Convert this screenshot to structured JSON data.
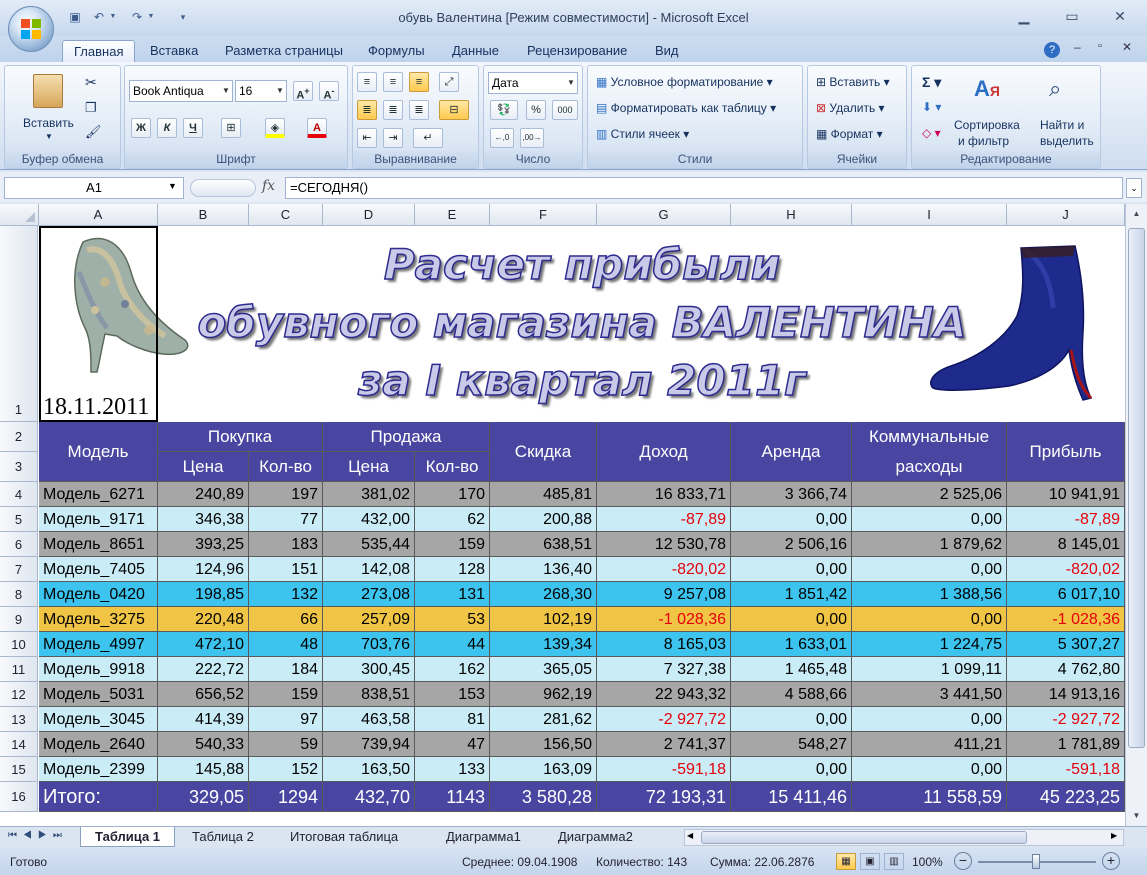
{
  "window": {
    "title": "обувь Валентина  [Режим совместимости] - Microsoft Excel"
  },
  "ribbon_tabs": [
    "Главная",
    "Вставка",
    "Разметка страницы",
    "Формулы",
    "Данные",
    "Рецензирование",
    "Вид"
  ],
  "ribbon": {
    "clipboard": {
      "paste": "Вставить",
      "title": "Буфер обмена"
    },
    "font": {
      "name": "Book Antiqua",
      "size": "16",
      "bold": "Ж",
      "italic": "К",
      "underline": "Ч",
      "title": "Шрифт"
    },
    "alignment": {
      "title": "Выравнивание"
    },
    "number": {
      "format": "Дата",
      "title": "Число"
    },
    "styles": {
      "conditional": "Условное форматирование",
      "as_table": "Форматировать как таблицу",
      "cell_styles": "Стили ячеек",
      "title": "Стили"
    },
    "cells": {
      "insert": "Вставить",
      "delete": "Удалить",
      "format": "Формат",
      "title": "Ячейки"
    },
    "editing": {
      "sort1": "Сортировка",
      "sort2": "и фильтр",
      "find1": "Найти и",
      "find2": "выделить",
      "title": "Редактирование"
    }
  },
  "formula_bar": {
    "name_box": "A1",
    "fx": "fx",
    "formula": "=СЕГОДНЯ()"
  },
  "columns": [
    "A",
    "B",
    "C",
    "D",
    "E",
    "F",
    "G",
    "H",
    "I",
    "J"
  ],
  "rows": [
    "1",
    "2",
    "3",
    "4",
    "5",
    "6",
    "7",
    "8",
    "9",
    "10",
    "11",
    "12",
    "13",
    "14",
    "15",
    "16"
  ],
  "banner": {
    "line1": "Расчет прибыли",
    "line2": "обувного магазина ВАЛЕНТИНА",
    "line3": "за I квартал 2011г",
    "date": "18.11.2011"
  },
  "table": {
    "header": {
      "model": "Модель",
      "purchase": "Покупка",
      "sale": "Продажа",
      "price": "Цена",
      "qty": "Кол-во",
      "sale_price": "Цена",
      "sale_qty": "Кол-во",
      "discount": "Скидка",
      "income": "Доход",
      "rent": "Аренда",
      "utilities1": "Коммунальные",
      "utilities2": "расходы",
      "profit": "Прибыль"
    },
    "rows": [
      {
        "model": "Модель_6271",
        "bp": "240,89",
        "bq": "197",
        "sp": "381,02",
        "sq": "170",
        "disc": "485,81",
        "inc": "16 833,71",
        "rent": "3 366,74",
        "util": "2 525,06",
        "profit": "10 941,91",
        "fill": "#a6a6a6",
        "neg": false
      },
      {
        "model": "Модель_9171",
        "bp": "346,38",
        "bq": "77",
        "sp": "432,00",
        "sq": "62",
        "disc": "200,88",
        "inc": "-87,89",
        "rent": "0,00",
        "util": "0,00",
        "profit": "-87,89",
        "fill": "#c9ecf6",
        "neg": true
      },
      {
        "model": "Модель_8651",
        "bp": "393,25",
        "bq": "183",
        "sp": "535,44",
        "sq": "159",
        "disc": "638,51",
        "inc": "12 530,78",
        "rent": "2 506,16",
        "util": "1 879,62",
        "profit": "8 145,01",
        "fill": "#a6a6a6",
        "neg": false
      },
      {
        "model": "Модель_7405",
        "bp": "124,96",
        "bq": "151",
        "sp": "142,08",
        "sq": "128",
        "disc": "136,40",
        "inc": "-820,02",
        "rent": "0,00",
        "util": "0,00",
        "profit": "-820,02",
        "fill": "#c9ecf6",
        "neg": true
      },
      {
        "model": "Модель_0420",
        "bp": "198,85",
        "bq": "132",
        "sp": "273,08",
        "sq": "131",
        "disc": "268,30",
        "inc": "9 257,08",
        "rent": "1 851,42",
        "util": "1 388,56",
        "profit": "6 017,10",
        "fill": "#3cc3ee",
        "neg": false
      },
      {
        "model": "Модель_3275",
        "bp": "220,48",
        "bq": "66",
        "sp": "257,09",
        "sq": "53",
        "disc": "102,19",
        "inc": "-1 028,36",
        "rent": "0,00",
        "util": "0,00",
        "profit": "-1 028,36",
        "fill": "#f0c445",
        "neg": true
      },
      {
        "model": "Модель_4997",
        "bp": "472,10",
        "bq": "48",
        "sp": "703,76",
        "sq": "44",
        "disc": "139,34",
        "inc": "8 165,03",
        "rent": "1 633,01",
        "util": "1 224,75",
        "profit": "5 307,27",
        "fill": "#3cc3ee",
        "neg": false
      },
      {
        "model": "Модель_9918",
        "bp": "222,72",
        "bq": "184",
        "sp": "300,45",
        "sq": "162",
        "disc": "365,05",
        "inc": "7 327,38",
        "rent": "1 465,48",
        "util": "1 099,11",
        "profit": "4 762,80",
        "fill": "#c9ecf6",
        "neg": false
      },
      {
        "model": "Модель_5031",
        "bp": "656,52",
        "bq": "159",
        "sp": "838,51",
        "sq": "153",
        "disc": "962,19",
        "inc": "22 943,32",
        "rent": "4 588,66",
        "util": "3 441,50",
        "profit": "14 913,16",
        "fill": "#a6a6a6",
        "neg": false
      },
      {
        "model": "Модель_3045",
        "bp": "414,39",
        "bq": "97",
        "sp": "463,58",
        "sq": "81",
        "disc": "281,62",
        "inc": "-2 927,72",
        "rent": "0,00",
        "util": "0,00",
        "profit": "-2 927,72",
        "fill": "#c9ecf6",
        "neg": true
      },
      {
        "model": "Модель_2640",
        "bp": "540,33",
        "bq": "59",
        "sp": "739,94",
        "sq": "47",
        "disc": "156,50",
        "inc": "2 741,37",
        "rent": "548,27",
        "util": "411,21",
        "profit": "1 781,89",
        "fill": "#a6a6a6",
        "neg": false
      },
      {
        "model": "Модель_2399",
        "bp": "145,88",
        "bq": "152",
        "sp": "163,50",
        "sq": "133",
        "disc": "163,09",
        "inc": "-591,18",
        "rent": "0,00",
        "util": "0,00",
        "profit": "-591,18",
        "fill": "#c9ecf6",
        "neg": true
      }
    ],
    "total": {
      "label": "Итого:",
      "bp": "329,05",
      "bq": "1294",
      "sp": "432,70",
      "sq": "1143",
      "disc": "3 580,28",
      "inc": "72 193,31",
      "rent": "15 411,46",
      "util": "11 558,59",
      "profit": "45 223,25"
    }
  },
  "sheet_tabs": [
    "Таблица 1",
    "Таблица 2",
    "Итоговая таблица",
    "Диаграмма1",
    "Диаграмма2"
  ],
  "status": {
    "ready": "Готово",
    "average": "Среднее: 09.04.1908",
    "count": "Количество: 143",
    "sum": "Сумма: 22.06.2876",
    "zoom": "100%"
  },
  "colors": {
    "header_fill": "#4846a0",
    "negative": "#e6000a",
    "grey": "#a6a6a6",
    "lightblue": "#c9ecf6",
    "cyan": "#3cc3ee",
    "yellow": "#f0c445"
  }
}
